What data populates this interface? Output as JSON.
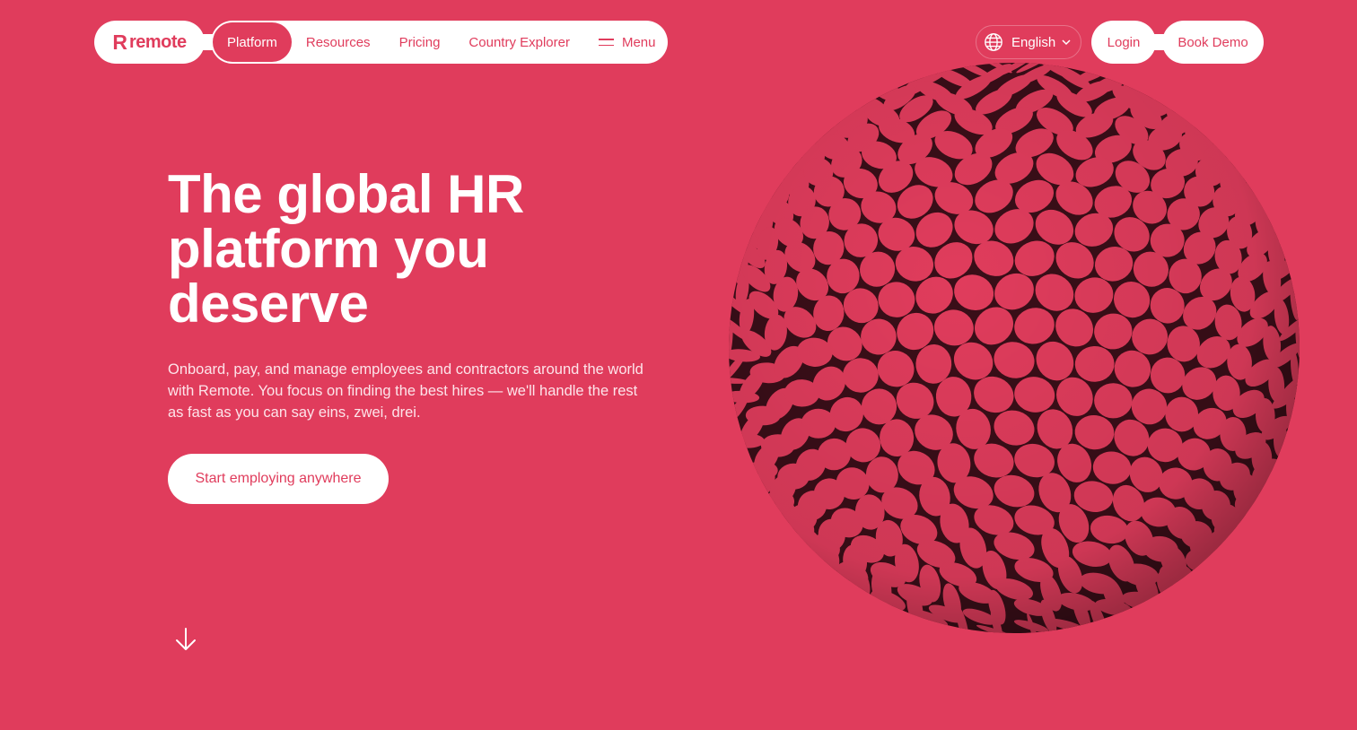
{
  "brand": {
    "name": "remote",
    "mark": "R",
    "primary_color": "#e03c5c",
    "sphere_dark_color": "#3a0e18"
  },
  "nav": {
    "items": [
      {
        "label": "Platform",
        "active": true
      },
      {
        "label": "Resources",
        "active": false
      },
      {
        "label": "Pricing",
        "active": false
      },
      {
        "label": "Country Explorer",
        "active": false
      }
    ],
    "menu_label": "Menu",
    "menu_icon": "hamburger-icon"
  },
  "header_right": {
    "language": "English",
    "language_icon": "globe-icon",
    "dropdown_icon": "chevron-down-icon",
    "login_label": "Login",
    "demo_label": "Book Demo"
  },
  "hero": {
    "title_lines": [
      "The global HR",
      "platform you",
      "deserve"
    ],
    "subtitle": "Onboard, pay, and manage employees and contractors around the world with Remote. You focus on finding the best hires — we'll handle the rest as fast as you can say eins, zwei, drei.",
    "cta_label": "Start employing anywhere",
    "scroll_icon": "arrow-down-icon",
    "decoration_icon": "knit-sphere-illustration"
  }
}
